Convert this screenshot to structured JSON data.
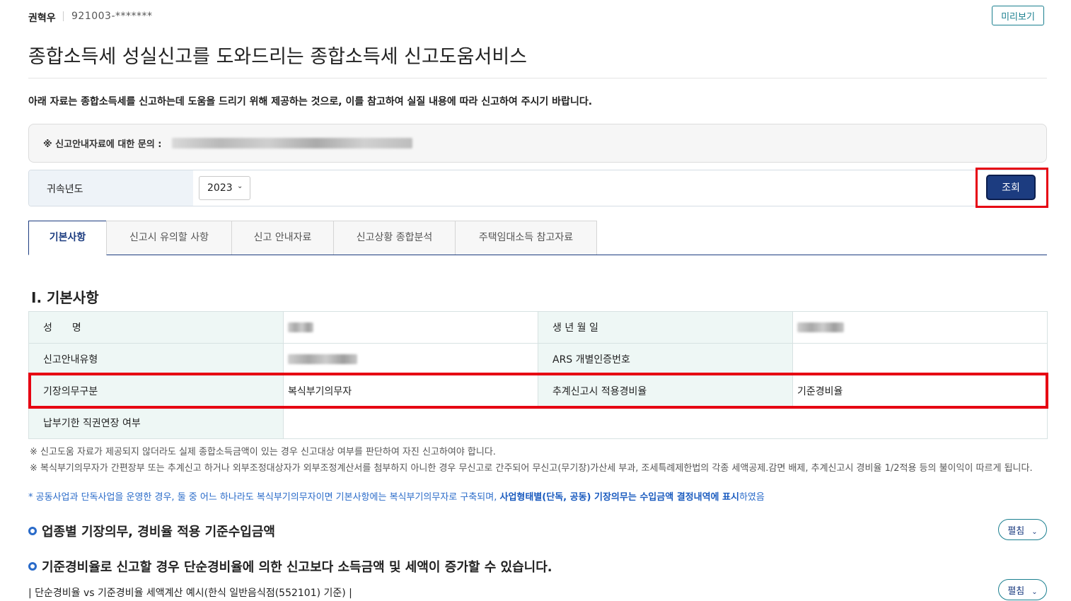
{
  "header": {
    "user_name": "권혁우",
    "user_id": "921003-*******",
    "preview_label": "미리보기"
  },
  "page_title": "종합소득세 성실신고를 도와드리는 종합소득세 신고도움서비스",
  "intro_text": "아래 자료는 종합소득세를 신고하는데 도움을 드리기 위해 제공하는 것으로, 이를 참고하여 실질 내용에 따라 신고하여 주시기 바랍니다.",
  "inquiry": {
    "label": "※ 신고안내자료에 대한 문의 :"
  },
  "year_filter": {
    "label": "귀속년도",
    "selected": "2023",
    "search_label": "조회"
  },
  "tabs": [
    {
      "label": "기본사항",
      "active": true
    },
    {
      "label": "신고시 유의할 사항",
      "active": false
    },
    {
      "label": "신고 안내자료",
      "active": false
    },
    {
      "label": "신고상황 종합분석",
      "active": false
    },
    {
      "label": "주택임대소득 참고자료",
      "active": false
    }
  ],
  "section_title": "Ⅰ. 기본사항",
  "basic_table": {
    "name_label": "성　　명",
    "birth_label": "생 년 월 일",
    "guide_type_label": "신고안내유형",
    "ars_label": "ARS 개별인증번호",
    "ars_value": "",
    "bookkeeping_label": "기장의무구분",
    "bookkeeping_value": "복식부기의무자",
    "estimate_label": "추계신고시 적용경비율",
    "estimate_value": "기준경비율",
    "extension_label": "납부기한 직권연장 여부",
    "extension_value": ""
  },
  "notes": {
    "note1": "※ 신고도움 자료가 제공되지 않더라도 실제 종합소득금액이 있는 경우 신고대상 여부를 판단하여 자진 신고하여야 합니다.",
    "note2": "※ 복식부기의무자가 간편장부 또는 추계신고 하거나 외부조정대상자가 외부조정계산서를 첨부하지 아니한 경우 무신고로 간주되어 무신고(무기장)가산세 부과, 조세특례제한법의 각종 세액공제.감면 배제, 추계신고시 경비율 1/2적용 등의 불이익이 따르게 됩니다.",
    "blue_part1": "* 공동사업과 단독사업을 운영한 경우, 둘 중 어느 하나라도 복식부기의무자이면 기본사항에는 복식부기의무자로 구축되며, ",
    "blue_bold": "사업형태별(단독, 공동) 기장의무는 수입금액 결정내역에 표시",
    "blue_part2": "하였음"
  },
  "sections": {
    "industry_heading": "업종별 기장의무, 경비율 적용 기준수입금액",
    "standard_heading": "기준경비율로 신고할 경우 단순경비율에 의한 신고보다 소득금액 및 세액이 증가할 수 있습니다.",
    "example_line": "| 단순경비율 vs 기준경비율 세액계산 예시(한식 일반음식점(552101) 기준) |",
    "expand_label": "펼침"
  },
  "colors": {
    "primary": "#1c3c80",
    "teal": "#1a7f8f",
    "highlight": "#e60012",
    "table_header_bg": "#eef7f5",
    "link_blue": "#2a6bc9"
  }
}
